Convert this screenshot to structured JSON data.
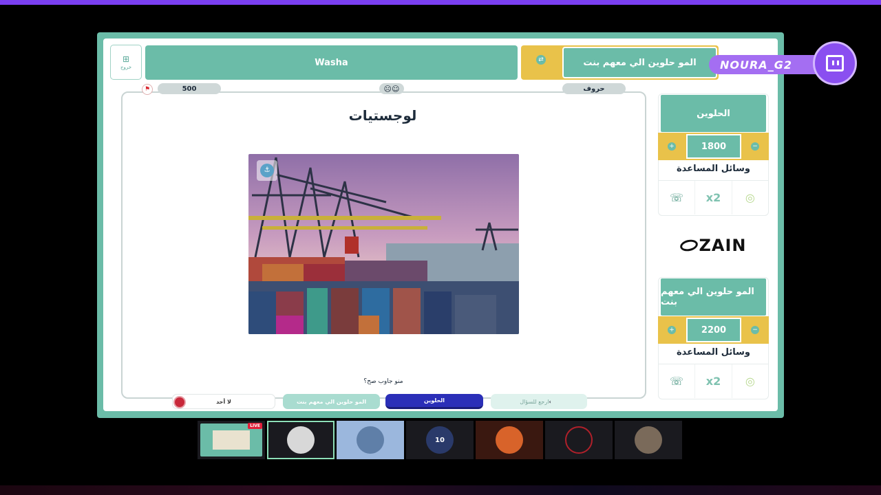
{
  "exit": {
    "label": "خروج",
    "icon": "exit-icon"
  },
  "teams": {
    "team_a": {
      "name": "Washa"
    },
    "team_b": {
      "name": "المو حلوين الي معهم بنت"
    }
  },
  "question": {
    "points": "500",
    "category": "حروف",
    "title": "لوجستيات",
    "who_answered": "منو جاوب صح؟"
  },
  "answers": {
    "none": "لا أحد",
    "team_b": "المو حلوين الي معهم بنت",
    "team_a": "الحلوين",
    "back": "ارجع للسؤال",
    "back_icon": "chevron-left-icon"
  },
  "sidebar": {
    "top": {
      "name": "الحلوين",
      "score": "1800",
      "aids_title": "وسائل المساعدة"
    },
    "bottom": {
      "name": "المو حلوين الي معهم بنت",
      "score": "2200",
      "aids_title": "وسائل المساعدة"
    },
    "sponsor": "ZAIN"
  },
  "stream": {
    "channel": "NOURA_G2",
    "live_badge": "LIVE",
    "jersey_number": "10"
  },
  "colors": {
    "teal": "#6bbca8",
    "gold": "#e9c24a",
    "purple": "#8a4ff0",
    "blue": "#2b2fb8",
    "red": "#c8283a"
  }
}
